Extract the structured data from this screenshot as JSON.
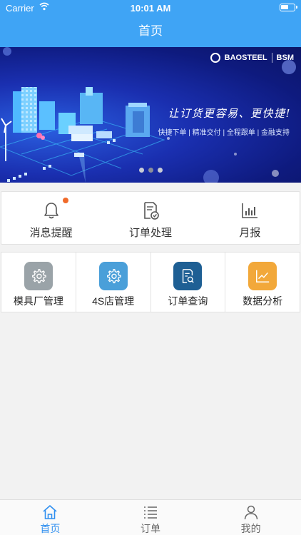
{
  "status_bar": {
    "carrier": "Carrier",
    "time": "10:01 AM"
  },
  "nav": {
    "title": "首页"
  },
  "banner": {
    "brand_name": "BAOSTEEL",
    "brand_sub": "BSM",
    "slogan": "让订货更容易、更快捷!",
    "tags": "快捷下单 | 精准交付 | 全程跟单 | 金融支持",
    "page_count": 3,
    "active_page": 2
  },
  "quick_actions": [
    {
      "label": "消息提醒",
      "icon": "bell-icon",
      "has_badge": true
    },
    {
      "label": "订单处理",
      "icon": "order-check-icon"
    },
    {
      "label": "月报",
      "icon": "bar-chart-icon"
    }
  ],
  "modules": [
    {
      "label": "模具厂管理",
      "icon": "gear-icon",
      "color": "#9aa3a8"
    },
    {
      "label": "4S店管理",
      "icon": "gear-icon",
      "color": "#4a9fd9"
    },
    {
      "label": "订单查询",
      "icon": "doc-search-icon",
      "color": "#1e5f94"
    },
    {
      "label": "数据分析",
      "icon": "line-chart-icon",
      "color": "#f2a83a"
    }
  ],
  "tabs": [
    {
      "label": "首页",
      "icon": "home-icon",
      "active": true
    },
    {
      "label": "订单",
      "icon": "list-icon",
      "active": false
    },
    {
      "label": "我的",
      "icon": "user-icon",
      "active": false
    }
  ],
  "colors": {
    "primary": "#3fa4f5",
    "tab_active": "#2f8ff0",
    "badge": "#f06a2a"
  }
}
